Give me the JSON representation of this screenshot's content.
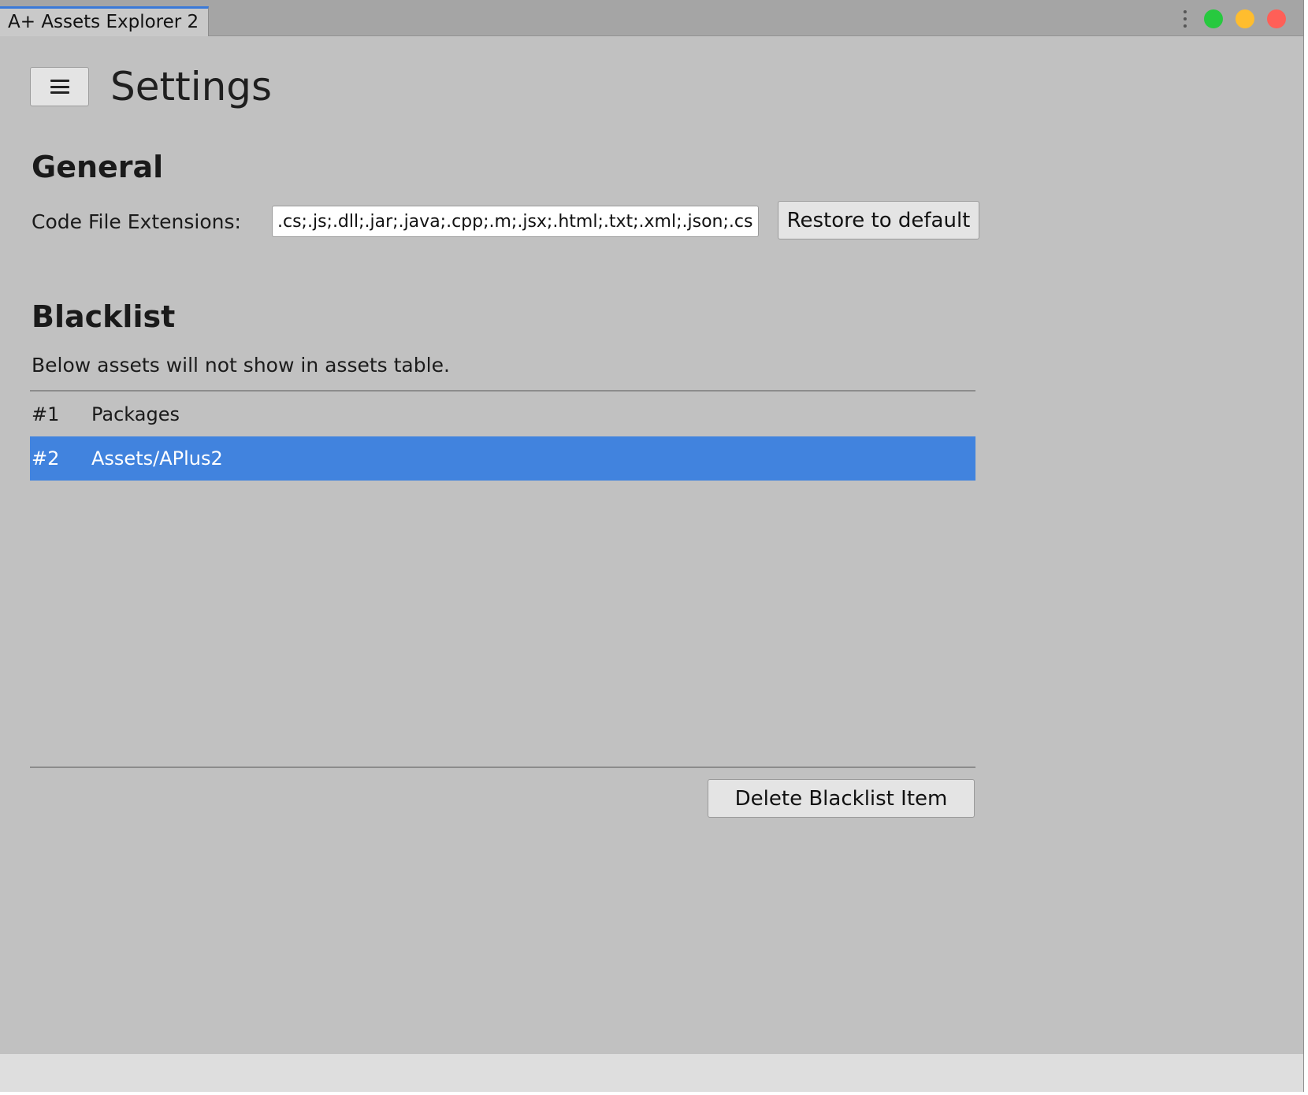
{
  "window": {
    "tab_title": "A+ Assets Explorer 2"
  },
  "header": {
    "title": "Settings",
    "menu_icon": "hamburger-icon"
  },
  "general": {
    "heading": "General",
    "code_ext_label": "Code File Extensions:",
    "code_ext_value": ".cs;.js;.dll;.jar;.java;.cpp;.m;.jsx;.html;.txt;.xml;.json;.csv;.h",
    "restore_label": "Restore to default"
  },
  "blacklist": {
    "heading": "Blacklist",
    "description": "Below assets will not show in assets table.",
    "items": [
      {
        "index": "#1",
        "value": "Packages",
        "selected": false
      },
      {
        "index": "#2",
        "value": "Assets/APlus2",
        "selected": true
      }
    ],
    "delete_label": "Delete Blacklist Item"
  },
  "colors": {
    "selection": "#4183de",
    "background": "#c1c1c1",
    "close": "#ff5f57",
    "minimize": "#ffbd2e",
    "maximize": "#27c93f"
  }
}
